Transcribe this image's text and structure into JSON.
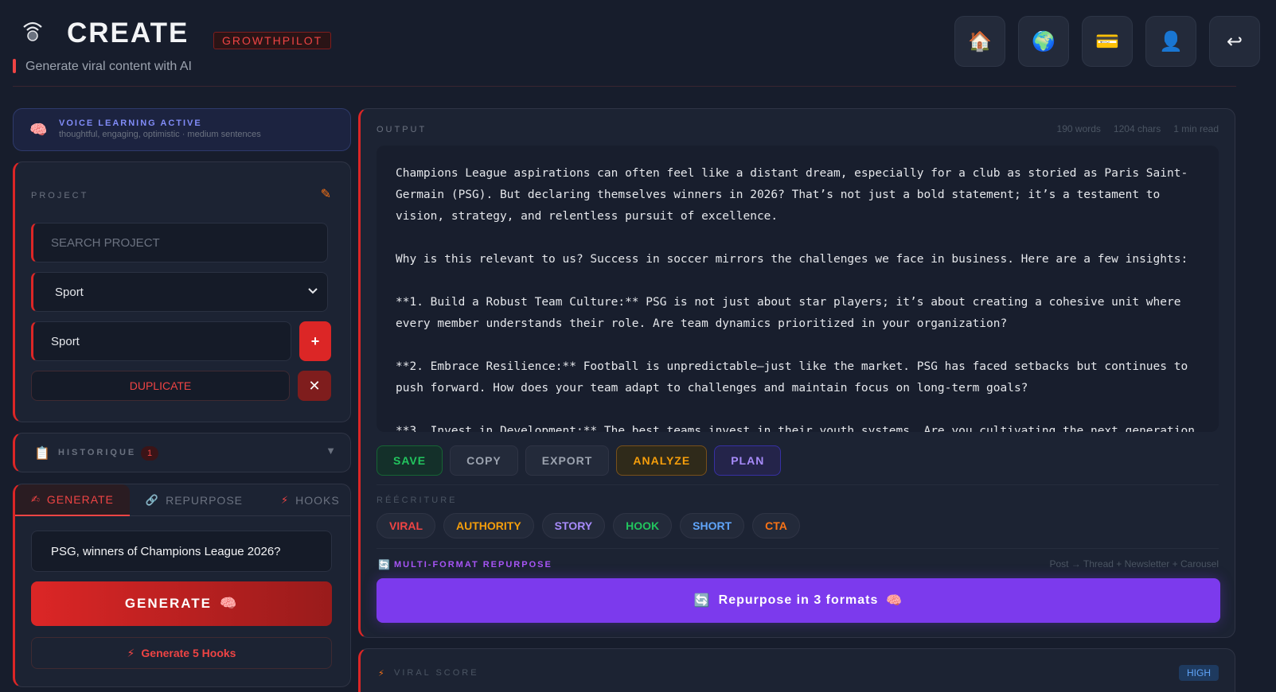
{
  "header": {
    "title": "CREATE",
    "brand": "GROWTHPILOT",
    "subtitle": "Generate viral content with AI",
    "nav": [
      {
        "icon": "house-icon",
        "glyph": "🏠"
      },
      {
        "icon": "globe-icon",
        "glyph": "🌍"
      },
      {
        "icon": "credit-card-icon",
        "glyph": "💳"
      },
      {
        "icon": "user-icon",
        "glyph": "👤"
      },
      {
        "icon": "return-arrow-icon",
        "glyph": "↩"
      }
    ]
  },
  "voice": {
    "icon": "brain-icon",
    "title": "VOICE LEARNING ACTIVE",
    "description": "thoughtful, engaging, optimistic · medium sentences"
  },
  "project": {
    "label": "PROJECT",
    "search_placeholder": "SEARCH PROJECT",
    "selected": "Sport",
    "name_value": "Sport",
    "add_label": "+",
    "duplicate_label": "DUPLICATE",
    "delete_label": "✕"
  },
  "history": {
    "label": "HISTORIQUE",
    "count": "1",
    "caret": "▼"
  },
  "generate": {
    "tabs": [
      {
        "label": "GENERATE",
        "icon": "writing-hand-icon",
        "glyph": "✍"
      },
      {
        "label": "REPURPOSE",
        "icon": "link-icon",
        "glyph": "🔗"
      },
      {
        "label": "HOOKS",
        "icon": "lightning-icon",
        "glyph": "⚡"
      }
    ],
    "topic": "PSG, winners of Champions League 2026?",
    "generate_label": "GENERATE",
    "hooks_label": "Generate 5 Hooks"
  },
  "output": {
    "label": "OUTPUT",
    "words": "190 words",
    "chars": "1204 chars",
    "read": "1 min read",
    "paragraphs": [
      "Champions League aspirations can often feel like a distant dream, especially for a club as storied as Paris Saint-Germain (PSG). But declaring themselves winners in 2026? That’s not just a bold statement; it’s a testament to vision, strategy, and relentless pursuit of excellence.",
      "Why is this relevant to us? Success in soccer mirrors the challenges we face in business. Here are a few insights:",
      "**1. Build a Robust Team Culture:** PSG is not just about star players; it’s about creating a cohesive unit where every member understands their role. Are team dynamics prioritized in your organization?",
      "**2. Embrace Resilience:** Football is unpredictable—just like the market. PSG has faced setbacks but continues to push forward. How does your team adapt to challenges and maintain focus on long-term goals?",
      "**3. Invest in Development:** The best teams invest in their youth systems. Are you cultivating the next generation"
    ],
    "actions": {
      "save": "SAVE",
      "copy": "COPY",
      "export": "EXPORT",
      "analyze": "ANALYZE",
      "plan": "PLAN"
    },
    "rewrite_label": "RÉÉCRITURE",
    "rewrite": [
      {
        "label": "VIRAL",
        "color": "#ef4444"
      },
      {
        "label": "AUTHORITY",
        "color": "#f59e0b"
      },
      {
        "label": "STORY",
        "color": "#a78bfa"
      },
      {
        "label": "HOOK",
        "color": "#22c55e"
      },
      {
        "label": "SHORT",
        "color": "#60a5fa"
      },
      {
        "label": "CTA",
        "color": "#f97316"
      }
    ],
    "multiformat_label": "MULTI-FORMAT REPURPOSE",
    "multiformat_desc": "Post → Thread + Newsletter + Carousel",
    "repurpose_label": "Repurpose in 3 formats"
  },
  "viral": {
    "label": "VIRAL SCORE",
    "badge": "HIGH"
  }
}
